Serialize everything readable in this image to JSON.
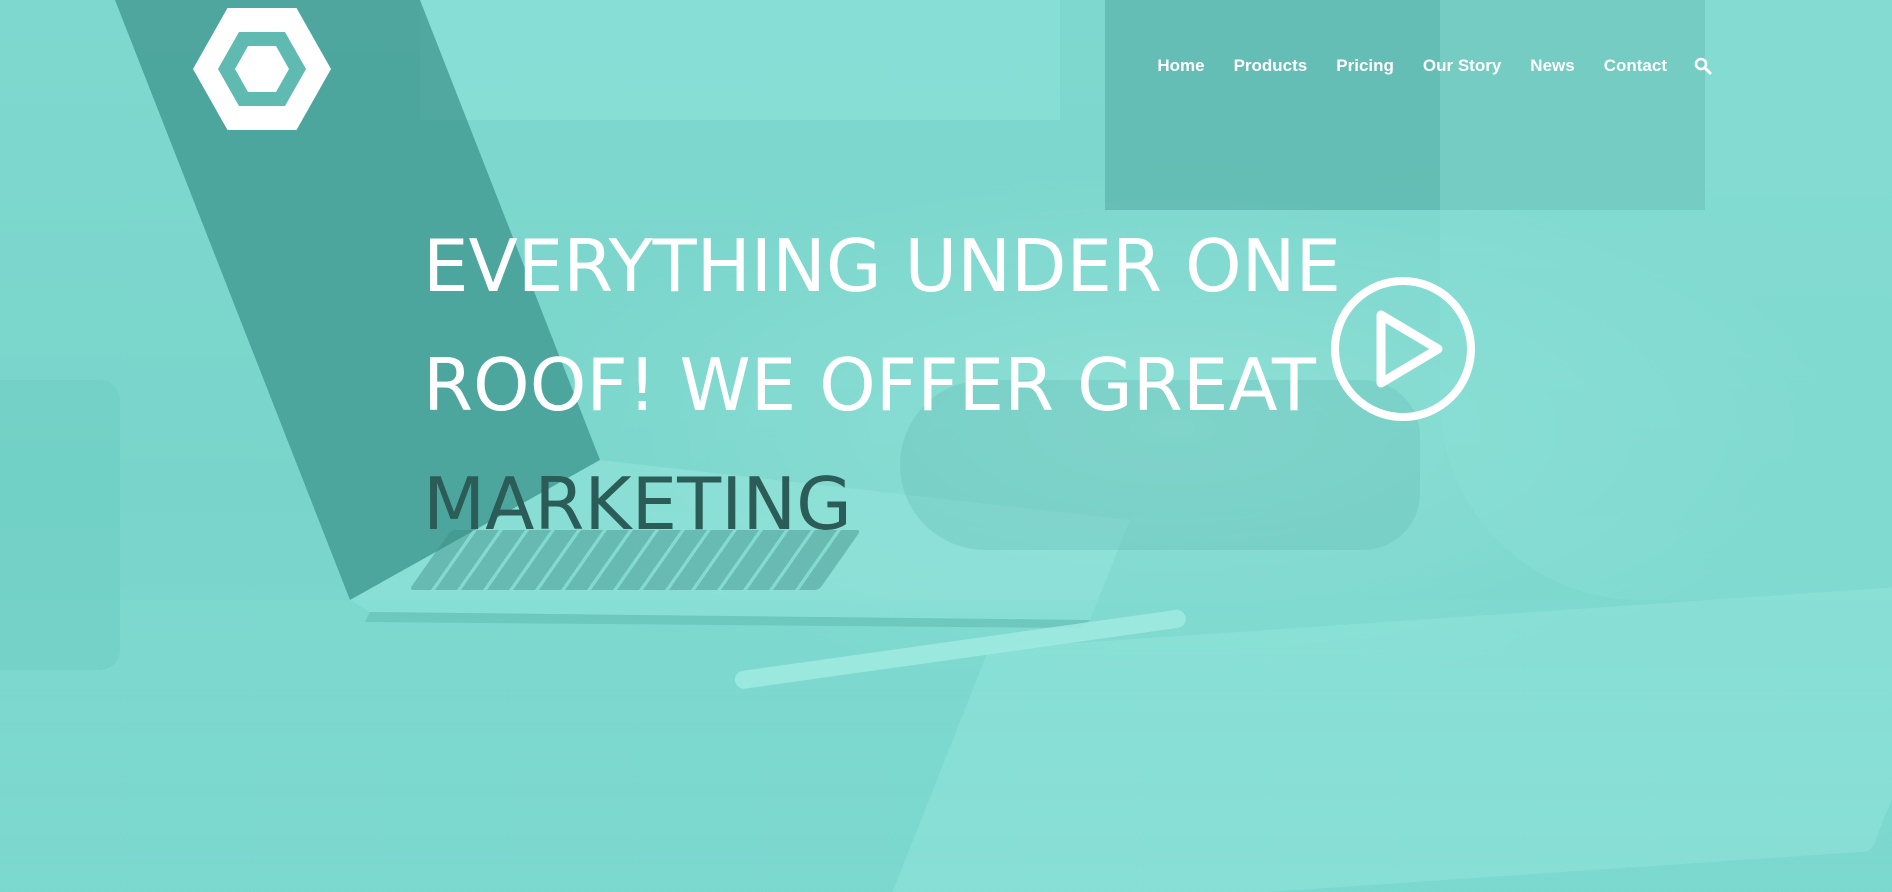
{
  "colors": {
    "overlay": "#7dd6cd",
    "text_light": "#ffffff",
    "text_accent": "#2b5c58"
  },
  "header": {
    "logo": {
      "icon": "hexagon-logo-icon"
    },
    "nav": {
      "items": [
        {
          "label": "Home"
        },
        {
          "label": "Products"
        },
        {
          "label": "Pricing"
        },
        {
          "label": "Our Story"
        },
        {
          "label": "News"
        },
        {
          "label": "Contact"
        }
      ],
      "search_icon": "search-icon"
    }
  },
  "hero": {
    "headline_line1": "EVERYTHING UNDER ONE",
    "headline_line2": "ROOF! WE OFFER GREAT",
    "headline_line3": "MARKETING",
    "play_icon": "play-circle-icon"
  }
}
